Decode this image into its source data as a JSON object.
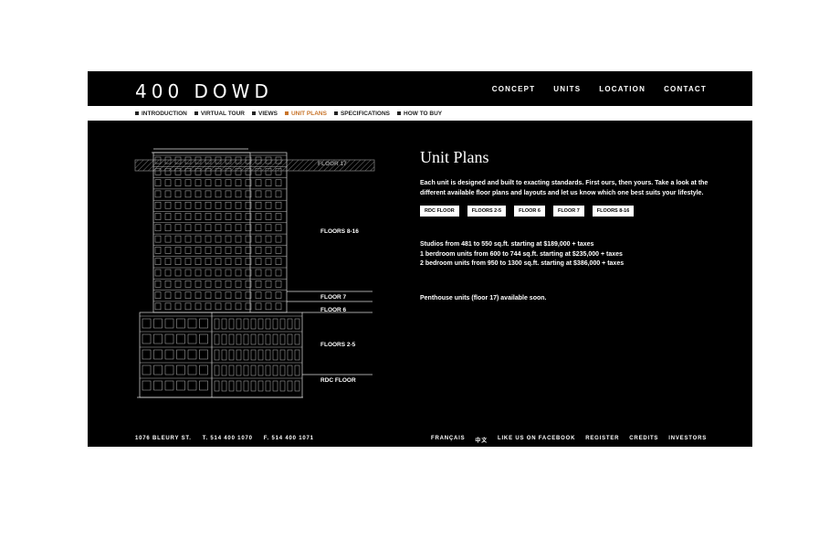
{
  "brand": {
    "logo": "400 DOWD"
  },
  "main_nav": [
    "CONCEPT",
    "UNITS",
    "LOCATION",
    "CONTACT"
  ],
  "sub_nav": [
    {
      "label": "INTRODUCTION",
      "active": false
    },
    {
      "label": "VIRTUAL TOUR",
      "active": false
    },
    {
      "label": "VIEWS",
      "active": false
    },
    {
      "label": "UNIT PLANS",
      "active": true
    },
    {
      "label": "SPECIFICATIONS",
      "active": false
    },
    {
      "label": "HOW TO BUY",
      "active": false
    }
  ],
  "building": {
    "floors": {
      "floor17": "FLOOR 17",
      "floors8_16": "FLOORS 8-16",
      "floor7": "FLOOR 7",
      "floor6": "FLOOR 6",
      "floors2_5": "FLOORS 2-5",
      "rdc": "RDC FLOOR"
    }
  },
  "content": {
    "title": "Unit Plans",
    "intro": "Each unit is designed and built to exacting standards. First ours, then yours. Take a look at the different available floor plans and layouts and let us know which one best suits your lifestyle.",
    "plan_buttons": [
      "RDC FLOOR",
      "FLOORS 2-5",
      "FLOOR 6",
      "FLOOR 7",
      "FLOORS 8-16"
    ],
    "pricing": [
      "Studios from 481 to 550 sq.ft. starting at $189,000 + taxes",
      "1 berdroom units from 600 to 744 sq.ft. starting at $235,000 + taxes",
      "2 bedroom units from 950 to 1300 sq.ft. starting at $386,000 + taxes"
    ],
    "penthouse": "Penthouse units (floor 17) available soon."
  },
  "footer": {
    "address": "1076 BLEURY ST.",
    "phone": "T. 514 400 1070",
    "fax": "F. 514 400 1071",
    "links": [
      "FRANÇAIS",
      "中文",
      "LIKE US ON FACEBOOK",
      "REGISTER",
      "CREDITS",
      "INVESTORS"
    ]
  },
  "colors": {
    "background": "#000000",
    "accent": "#c8742a",
    "subnav_bg": "#ffffff"
  }
}
